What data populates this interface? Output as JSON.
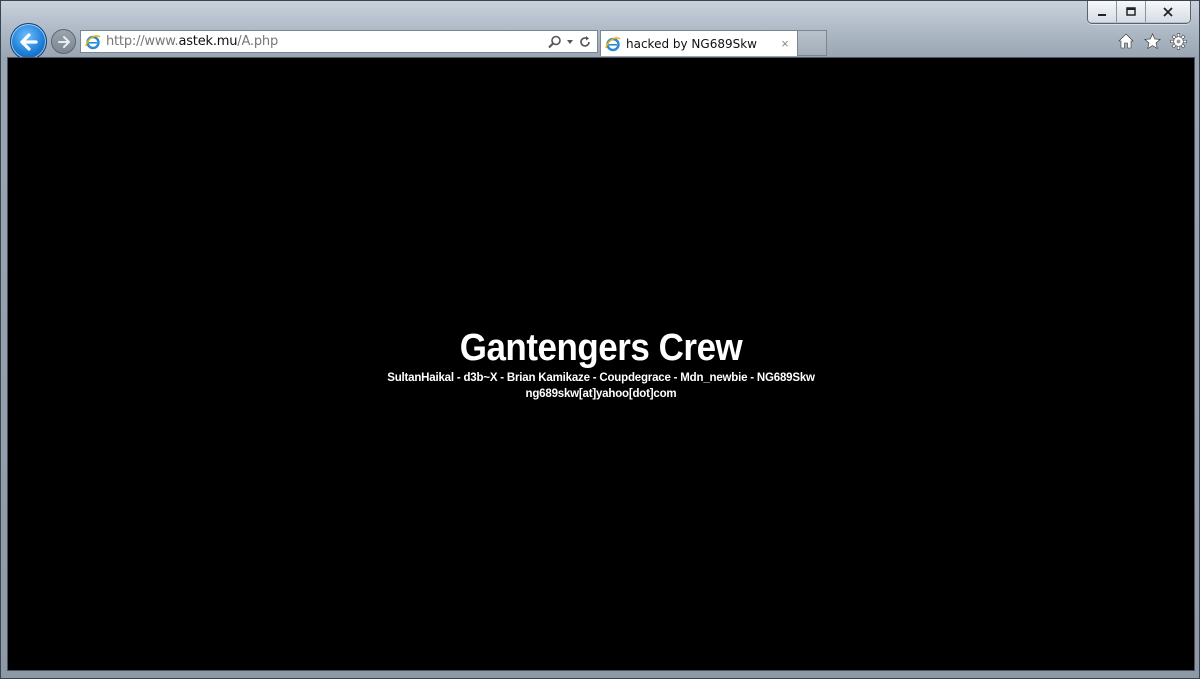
{
  "window": {
    "controls": [
      "minimize",
      "maximize",
      "close"
    ]
  },
  "nav": {
    "back_icon": "back-arrow-icon",
    "forward_icon": "forward-arrow-icon"
  },
  "address": {
    "prefix": "http://www.",
    "domain": "astek.mu",
    "path": "/A.php"
  },
  "tab": {
    "title": "hacked by NG689Skw",
    "close": "×"
  },
  "commands": [
    "home-icon",
    "favorites-star-icon",
    "tools-gear-icon"
  ],
  "page": {
    "headline": "Gantengers Crew",
    "members": "SultanHaikal - d3b~X - Brian Kamikaze - Coupdegrace - Mdn_newbie - NG689Skw",
    "email": "ng689skw[at]yahoo[dot]com",
    "background": "#000000",
    "text_color": "#ffffff"
  },
  "colors": {
    "back_button": "#1f7fd8",
    "frame": "#9aa6b3"
  }
}
